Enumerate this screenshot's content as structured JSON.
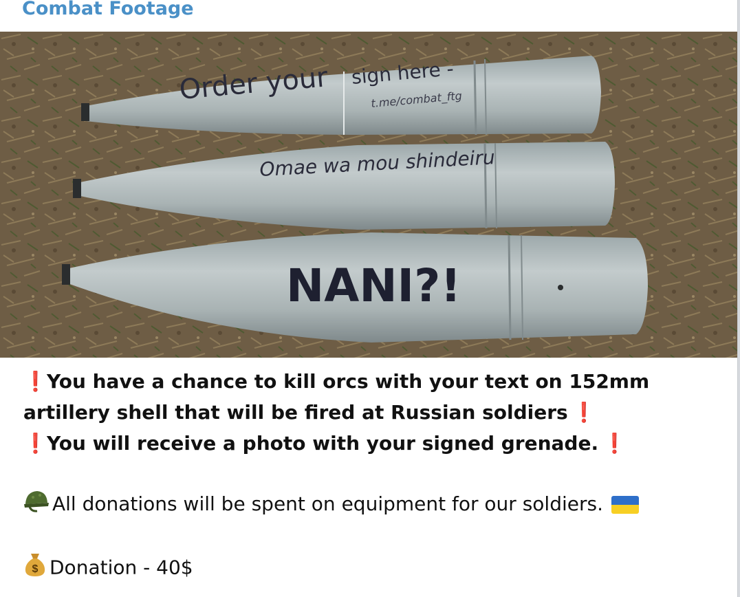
{
  "channel": {
    "name": "Combat Footage"
  },
  "photo": {
    "shell1": {
      "text_a": "Order your",
      "text_b": "sign here -",
      "text_c": "t.me/combat_ftg"
    },
    "shell2": {
      "text": "Omae wa mou shindeiru"
    },
    "shell3": {
      "text": "NANI?!"
    }
  },
  "message": {
    "line1": "You have a chance to kill orcs with your text on 152mm",
    "line2": "artillery shell that will be fired at Russian soldiers",
    "line3": "You will receive a photo with your signed grenade.",
    "line4": "All donations will be spent on equipment for our soldiers.",
    "line5": "Donation - 40$",
    "exclamation": "❗",
    "icons": {
      "warning": "exclamation-icon",
      "helmet": "military-helmet-icon",
      "flag": "ukraine-flag-icon",
      "money": "money-bag-icon"
    }
  },
  "colors": {
    "channel_name": "#4a90c7",
    "exclamation": "#e2231a",
    "flag_blue": "#2e6fc9",
    "flag_yellow": "#f7cf24"
  }
}
